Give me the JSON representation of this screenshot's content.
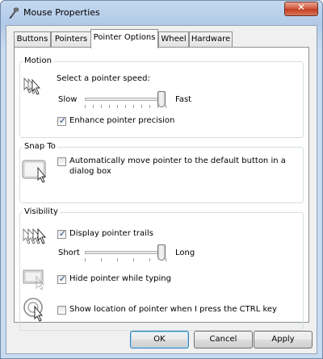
{
  "window": {
    "title": "Mouse Properties",
    "close_glyph": "✕"
  },
  "tabs": [
    {
      "label": "Buttons"
    },
    {
      "label": "Pointers"
    },
    {
      "label": "Pointer Options",
      "active": true
    },
    {
      "label": "Wheel"
    },
    {
      "label": "Hardware"
    }
  ],
  "motion": {
    "group_label": "Motion",
    "speed_label": "Select a pointer speed:",
    "slow_label": "Slow",
    "fast_label": "Fast",
    "speed_fraction": 0.95,
    "enhance_label": "Enhance pointer precision",
    "enhance_checked": true
  },
  "snap_to": {
    "group_label": "Snap To",
    "auto_move_label_line1": "Automatically move pointer to the default button in a",
    "auto_move_label_line2": "dialog box",
    "auto_move_checked": false
  },
  "visibility": {
    "group_label": "Visibility",
    "trails_label": "Display pointer trails",
    "trails_checked": true,
    "short_label": "Short",
    "long_label": "Long",
    "trail_fraction": 0.95,
    "hide_label": "Hide pointer while typing",
    "hide_checked": true,
    "ctrl_label": "Show location of pointer when I press the CTRL key",
    "ctrl_checked": false
  },
  "buttons": {
    "ok": "OK",
    "cancel": "Cancel",
    "apply": "Apply"
  },
  "icons": {
    "title": "mouse-properties-icon",
    "motion": "pointer-motion-icon",
    "snap": "snap-to-button-icon",
    "trails": "pointer-trails-icon",
    "hide": "hide-pointer-icon",
    "ctrl": "pointer-location-icon"
  },
  "colors": {
    "check": "#2b4a8a",
    "title_bar": "#b2cae8",
    "close_button": "#c23c1e"
  }
}
